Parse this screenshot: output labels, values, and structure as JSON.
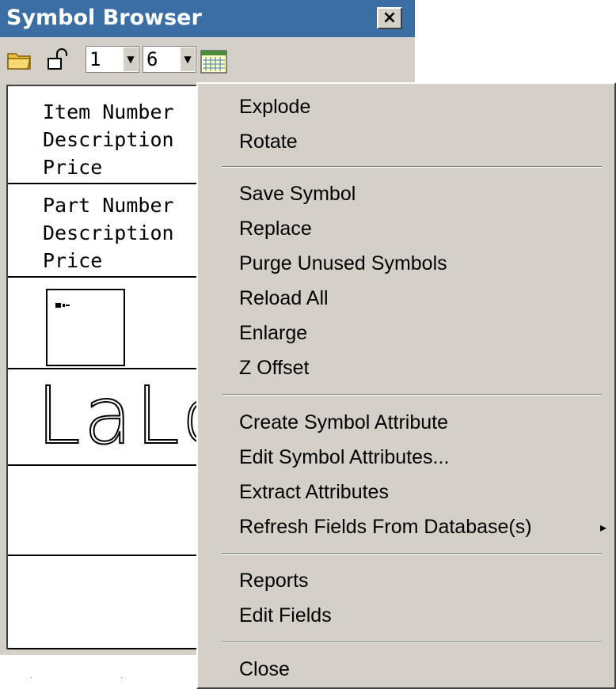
{
  "window": {
    "title": "Symbol Browser",
    "close_glyph": "×"
  },
  "toolbar": {
    "icons": [
      "folder-icon",
      "unlock-icon",
      "calendar-icon"
    ],
    "spin1_value": "1",
    "spin2_value": "6",
    "arrow_glyph": "▼"
  },
  "list": {
    "row1": [
      "Item Number",
      "Description",
      "Price"
    ],
    "row2": [
      "Part Number",
      "Description",
      "Price"
    ],
    "row4_text": "LaLc"
  },
  "menu": {
    "groups": [
      [
        "Explode",
        "Rotate"
      ],
      [
        "Save Symbol",
        "Replace",
        "Purge Unused Symbols",
        "Reload All",
        "Enlarge",
        "Z Offset"
      ],
      [
        "Create Symbol Attribute",
        "Edit Symbol Attributes...",
        "Extract Attributes",
        "Refresh Fields From Database(s)"
      ],
      [
        "Reports",
        "Edit Fields"
      ],
      [
        "Close"
      ]
    ],
    "submenu_glyph": "▸"
  },
  "colors": {
    "titlebar": "#3a6ea5",
    "face": "#d4d0c8"
  }
}
